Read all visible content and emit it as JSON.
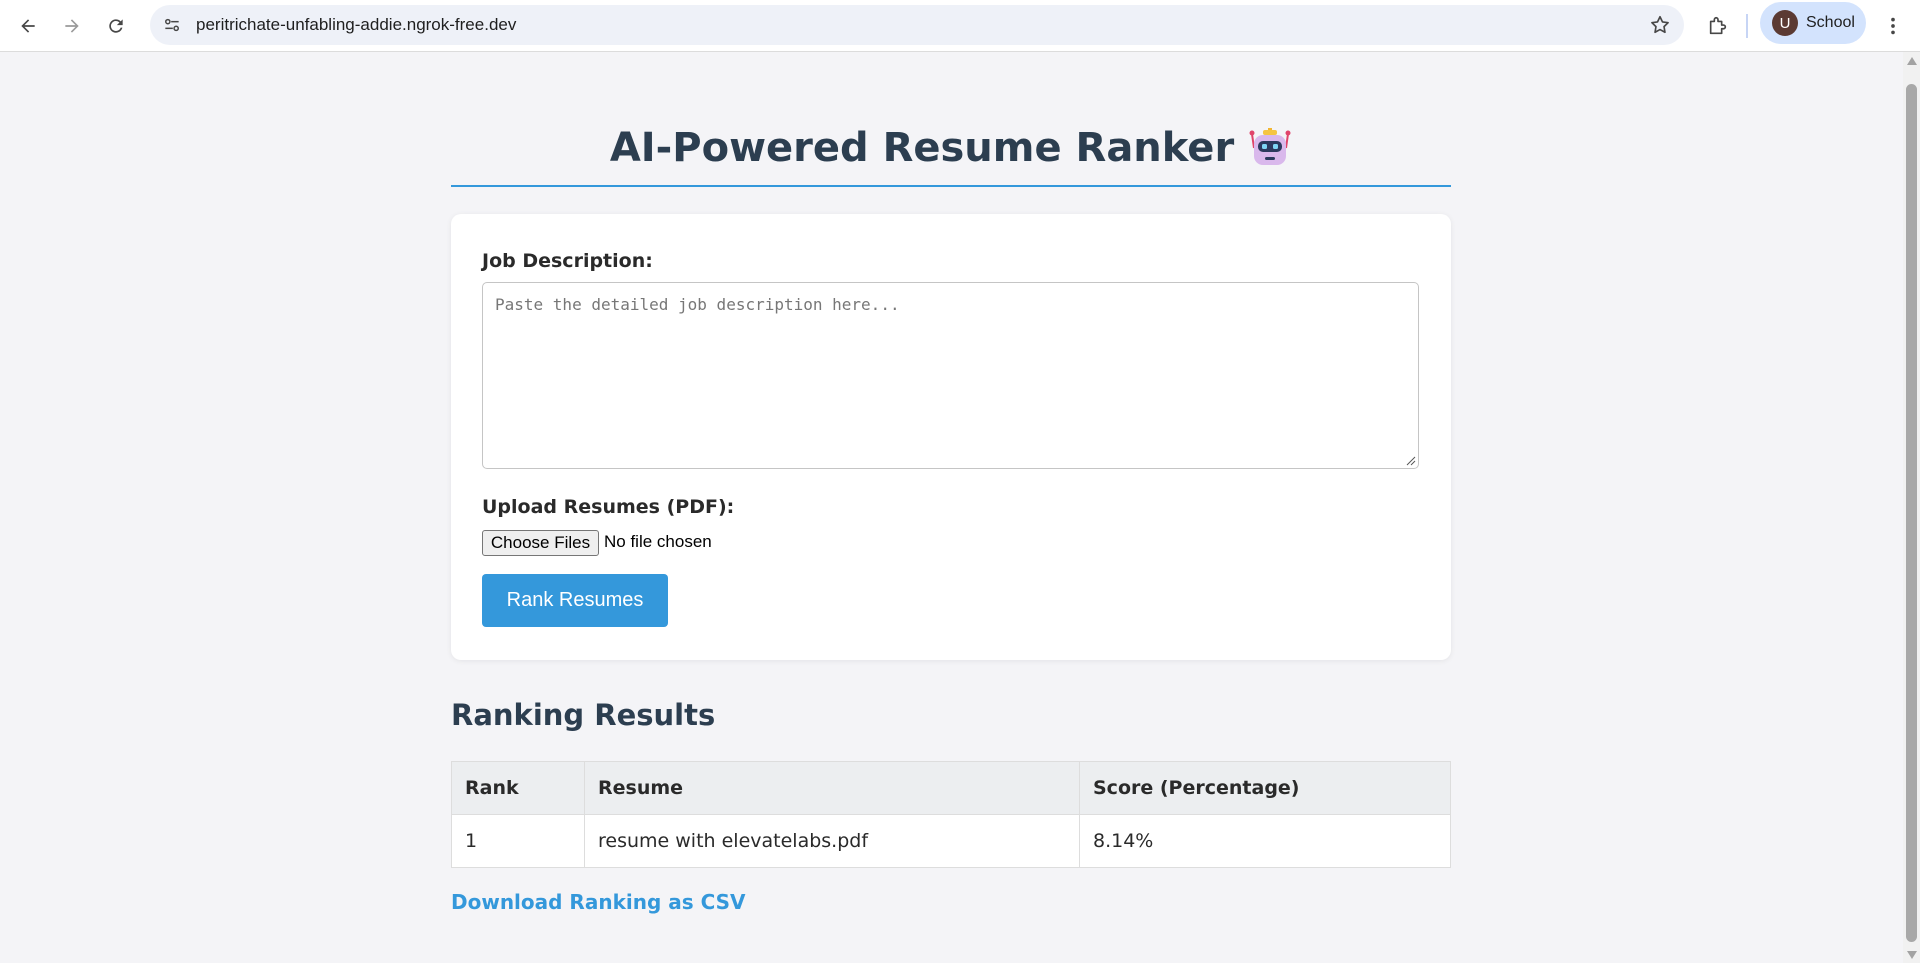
{
  "browser": {
    "url": "peritrichate-unfabling-addie.ngrok-free.dev",
    "profile_initial": "U",
    "profile_label": "School"
  },
  "page": {
    "title": "AI-Powered Resume Ranker",
    "title_icon": "robot-icon",
    "accent_color": "#3498db",
    "title_color": "#2c3e50"
  },
  "form": {
    "job_description_label": "Job Description:",
    "job_description_placeholder": "Paste the detailed job description here...",
    "job_description_value": "",
    "upload_label": "Upload Resumes (PDF):",
    "choose_files_label": "Choose Files",
    "file_status": "No file chosen",
    "submit_label": "Rank Resumes"
  },
  "results": {
    "title": "Ranking Results",
    "columns": [
      "Rank",
      "Resume",
      "Score (Percentage)"
    ],
    "rows": [
      {
        "rank": "1",
        "resume": "resume with elevatelabs.pdf",
        "score": "8.14%"
      }
    ],
    "download_label": "Download Ranking as CSV"
  }
}
